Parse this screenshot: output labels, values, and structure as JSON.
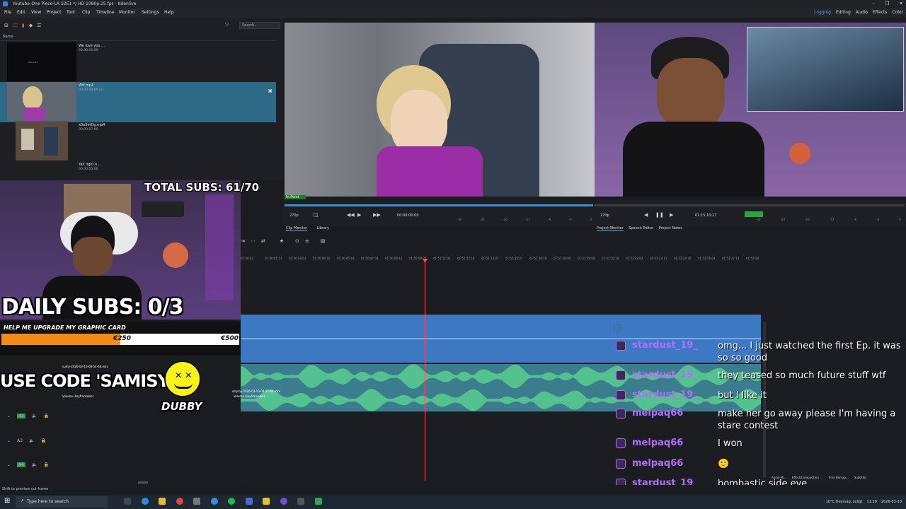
{
  "window": {
    "title": "Youtube-One Piece-LA S2E1 */ HD 1080p 25 fps - Kdenlive",
    "controls": [
      "–",
      "❐",
      "✕"
    ]
  },
  "menu": [
    "File",
    "Edit",
    "View",
    "Project",
    "Tool",
    "Clip",
    "Timeline",
    "Monitor",
    "Settings",
    "Help"
  ],
  "workspaces": [
    "Logging",
    "Editing",
    "Audio",
    "Effects",
    "Color"
  ],
  "bin": {
    "search_placeholder": "Search...",
    "header": "Name",
    "clips": [
      {
        "name": "We love you ...",
        "duration": "00:00:05:00"
      },
      {
        "name": "Wtf.mp4",
        "duration": "00:00:03:09 [1]"
      },
      {
        "name": "x0u9ktOg.mp4",
        "duration": "00:00:07:00"
      },
      {
        "name": "Yall right n...",
        "duration": "00:00:05:00"
      }
    ]
  },
  "clip_monitor": {
    "overlay_label": "In Point",
    "zoom": "270p",
    "timecode": "00:00:00:00",
    "tabs": [
      "Clip Monitor",
      "Library"
    ]
  },
  "project_monitor": {
    "zoom": "270p",
    "timecode": "01:15:10:27",
    "tabs": [
      "Project Monitor",
      "Speech Editor",
      "Project Notes"
    ]
  },
  "audio_meter_labels": [
    "-40",
    "-24",
    "-16",
    "-12",
    "-6",
    "-3",
    "0"
  ],
  "timeline": {
    "ruler": [
      "01:50:03",
      "01:50:01:17",
      "01:50:03:01",
      "01:50:04:10",
      "01:50:05:19",
      "01:50:07:03",
      "01:50:08:12",
      "01:50:09:21",
      "01:51:11:05",
      "01:51:12:14",
      "01:51:13:23",
      "01:51:15:07",
      "01:51:16:16",
      "01:51:18:00",
      "01:51:19:09",
      "01:52:20:18",
      "01:52:22:02",
      "01:52:23:11",
      "01:52:24:20",
      "01:52:26:04",
      "01:52:27:13",
      "01:52:28"
    ],
    "clip_names": [
      "sumy-2026-03-10-08-54-48.mkv",
      "display-2026-03-10-08-54-48.mkv"
    ],
    "effect_label": "Volume (keyframable)",
    "track_labels": [
      "A1",
      "A2",
      "A3",
      "A4"
    ]
  },
  "overlay": {
    "total_subs": "TOTAL SUBS: 61/70",
    "daily_subs": "DAILY SUBS: 0/3",
    "goal_title": "HELP ME UPGRADE MY GRAPHIC CARD",
    "goal_current": "€250",
    "goal_max": "€500",
    "goal_progress": 0.5,
    "code": "USE CODE 'SAMISY'",
    "sponsor": "DUBBY"
  },
  "chat": [
    {
      "user": "stardust_19_",
      "msg": "omg... I just watched the first Ep. it was so so good"
    },
    {
      "user": "stardust_19_",
      "msg": "they teased so much future stuff wtf"
    },
    {
      "user": "stardust_19_",
      "msg": "but I like it"
    },
    {
      "user": "melpaq66",
      "msg": "make her go away please I'm having a stare contest"
    },
    {
      "user": "melpaq66",
      "msg": "I won"
    },
    {
      "user": "melpaq66",
      "msg": "🙂"
    },
    {
      "user": "stardust_19_",
      "msg": "bombastic side eye"
    }
  ],
  "bottom_tabs": [
    "Audio Mi...",
    "Effect/Composition ...",
    "Time Remap...",
    "Subtitles"
  ],
  "status": "Shift to preview cut frame",
  "taskbar": {
    "search_placeholder": "Type here to search",
    "weather": "10°C  Overvag. soligt",
    "time": "11:29",
    "date": "2026-03-10"
  },
  "colors": {
    "accent": "#5a9fff",
    "selected_bin": "#2d6a88",
    "playhead": "#ff4b55",
    "video_track": "#3d79c2",
    "audio_wave": "#4fc08a",
    "twitch": "#b56cff"
  }
}
